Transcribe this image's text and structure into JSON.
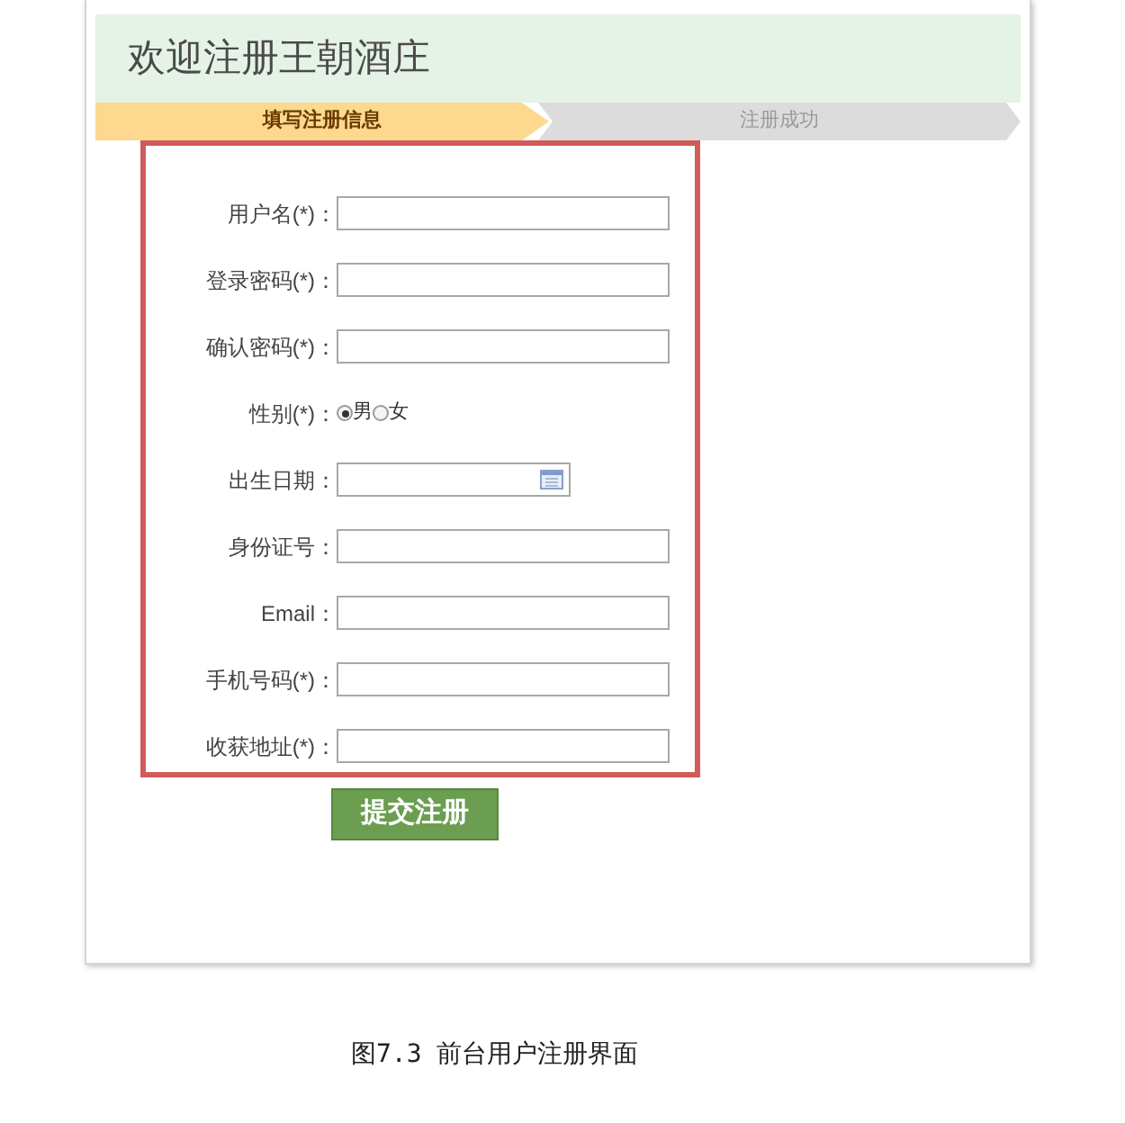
{
  "page_title": "欢迎注册王朝酒庄",
  "steps": [
    {
      "label": "填写注册信息",
      "selected": true
    },
    {
      "label": "注册成功",
      "selected": false
    }
  ],
  "fields": [
    {
      "kind": "text",
      "label": "用户名(*)："
    },
    {
      "kind": "text",
      "label": "登录密码(*)："
    },
    {
      "kind": "text",
      "label": "确认密码(*)："
    },
    {
      "kind": "radio",
      "label": "性别(*)：",
      "options": [
        {
          "label": "男",
          "selected": true
        },
        {
          "label": "女",
          "selected": false
        }
      ]
    },
    {
      "kind": "date",
      "label": "出生日期："
    },
    {
      "kind": "text",
      "label": "身份证号："
    },
    {
      "kind": "text",
      "label": "Email："
    },
    {
      "kind": "text",
      "label": "手机号码(*)："
    },
    {
      "kind": "text",
      "label": "收获地址(*)："
    }
  ],
  "submit_button": "提交注册",
  "caption": "图7.3 前台用户注册界面"
}
